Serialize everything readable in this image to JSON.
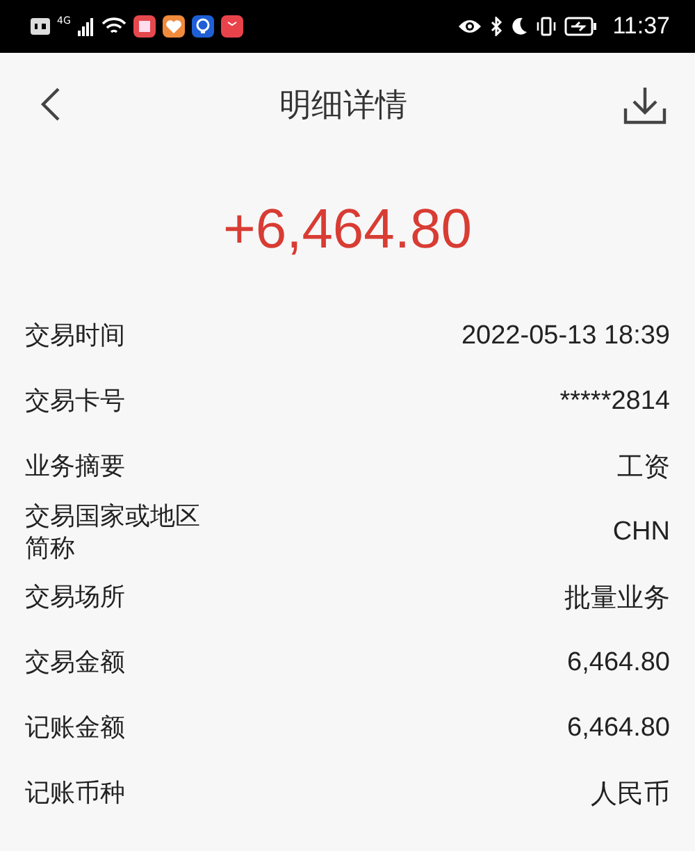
{
  "status_bar": {
    "time": "11:37",
    "network": "4G"
  },
  "header": {
    "title": "明细详情"
  },
  "amount": "+6,464.80",
  "details": [
    {
      "label": "交易时间",
      "value": "2022-05-13 18:39"
    },
    {
      "label": "交易卡号",
      "value": "*****2814"
    },
    {
      "label": "业务摘要",
      "value": "工资"
    },
    {
      "label": "交易国家或地区简称",
      "value": "CHN"
    },
    {
      "label": "交易场所",
      "value": "批量业务"
    },
    {
      "label": "交易金额",
      "value": "6,464.80"
    },
    {
      "label": "记账金额",
      "value": "6,464.80"
    },
    {
      "label": "记账币种",
      "value": "人民币"
    }
  ]
}
